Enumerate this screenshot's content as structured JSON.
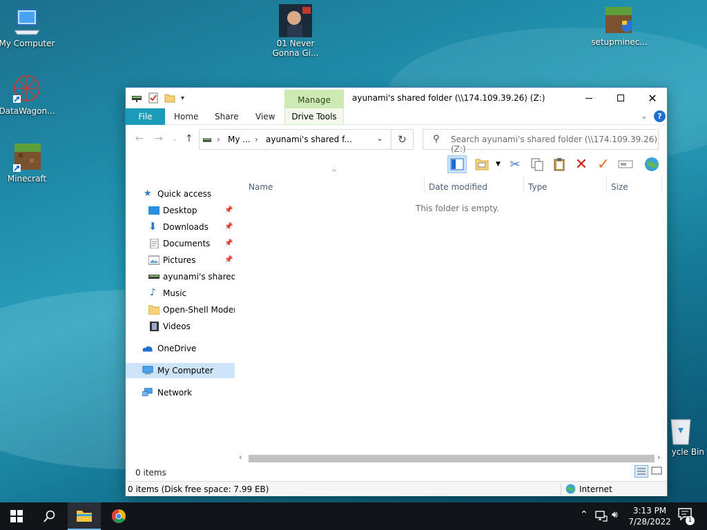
{
  "desktop": {
    "icons": [
      {
        "label": "My Computer"
      },
      {
        "label": "DataWagon..."
      },
      {
        "label": "Minecraft"
      },
      {
        "label": "01 Never Gonna Gi..."
      },
      {
        "label": "setupminec..."
      },
      {
        "label": "ycle Bin"
      }
    ]
  },
  "window": {
    "title": "ayunami's shared folder (\\\\174.109.39.26) (Z:)",
    "ribbon": {
      "manage": "Manage",
      "tabs": [
        "File",
        "Home",
        "Share",
        "View"
      ],
      "drive_tools": "Drive Tools"
    },
    "address": {
      "crumb1": "My ...",
      "crumb2": "ayunami's shared f...",
      "search_placeholder": "Search ayunami's shared folder (\\\\174.109.39.26) (Z:)"
    },
    "nav": {
      "items": [
        {
          "label": "Quick access"
        },
        {
          "label": "Desktop"
        },
        {
          "label": "Downloads"
        },
        {
          "label": "Documents"
        },
        {
          "label": "Pictures"
        },
        {
          "label": "ayunami's shared fo"
        },
        {
          "label": "Music"
        },
        {
          "label": "Open-Shell Modern"
        },
        {
          "label": "Videos"
        },
        {
          "label": "OneDrive"
        },
        {
          "label": "My Computer"
        },
        {
          "label": "Network"
        }
      ]
    },
    "columns": [
      "Name",
      "Date modified",
      "Type",
      "Size"
    ],
    "empty_text": "This folder is empty.",
    "status_items": "0 items",
    "status_bar": "0 items (Disk free space: 7.99 EB)",
    "zone": "Internet"
  },
  "taskbar": {
    "time": "3:13 PM",
    "date": "7/28/2022",
    "notification_count": "1"
  },
  "colors": {
    "accent": "#1a9bb7",
    "manage_tab": "#cfe9b5",
    "selected_nav": "#cce4f7"
  }
}
